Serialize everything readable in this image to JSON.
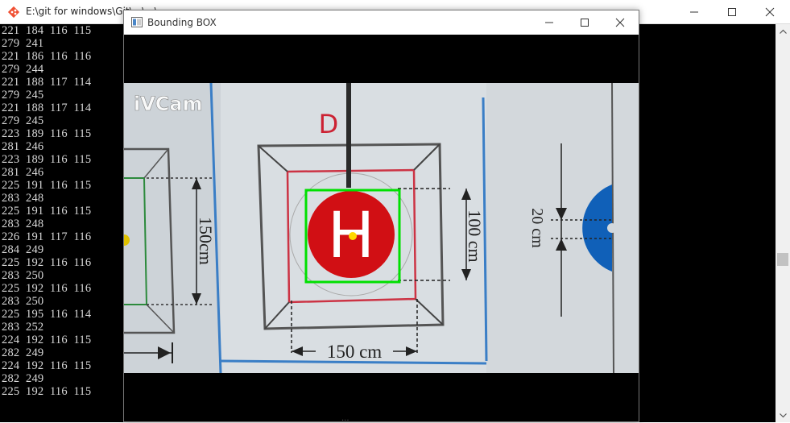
{
  "console": {
    "title": "E:\\git for windows\\Git\\...\\...\\...",
    "lines": [
      "221  184  116  115",
      "279  241",
      "221  186  116  116",
      "279  244",
      "221  188  117  114",
      "279  245",
      "221  188  117  114",
      "279  245",
      "223  189  116  115",
      "281  246",
      "223  189  116  115",
      "281  246",
      "225  191  116  115",
      "283  248",
      "225  191  116  115",
      "283  248",
      "226  191  117  116",
      "284  249",
      "225  192  116  116",
      "283  250",
      "225  192  116  116",
      "283  250",
      "225  195  116  114",
      "283  252",
      "224  192  116  115",
      "282  249",
      "224  192  116  115",
      "282  249",
      "225  192  116  115"
    ]
  },
  "window": {
    "title": "Bounding BOX",
    "minimize_icon": "minimize-icon",
    "maximize_icon": "maximize-icon",
    "close_icon": "close-icon"
  },
  "camera": {
    "watermark": "iVCam",
    "marker_letter": "D",
    "helipad_letter": "H",
    "dim_left": "150cm",
    "dim_right": "100 cm",
    "dim_bottom": "150 cm",
    "dim_far_right": "20 cm",
    "box_color": "#00e000",
    "center_color": "#ffd700",
    "pad_red": "#d10f14",
    "bottom_peek": "..."
  },
  "colors": {
    "console_bg": "#000000",
    "console_text": "#d8d8d8",
    "titlebar_bg": "#ffffff"
  }
}
